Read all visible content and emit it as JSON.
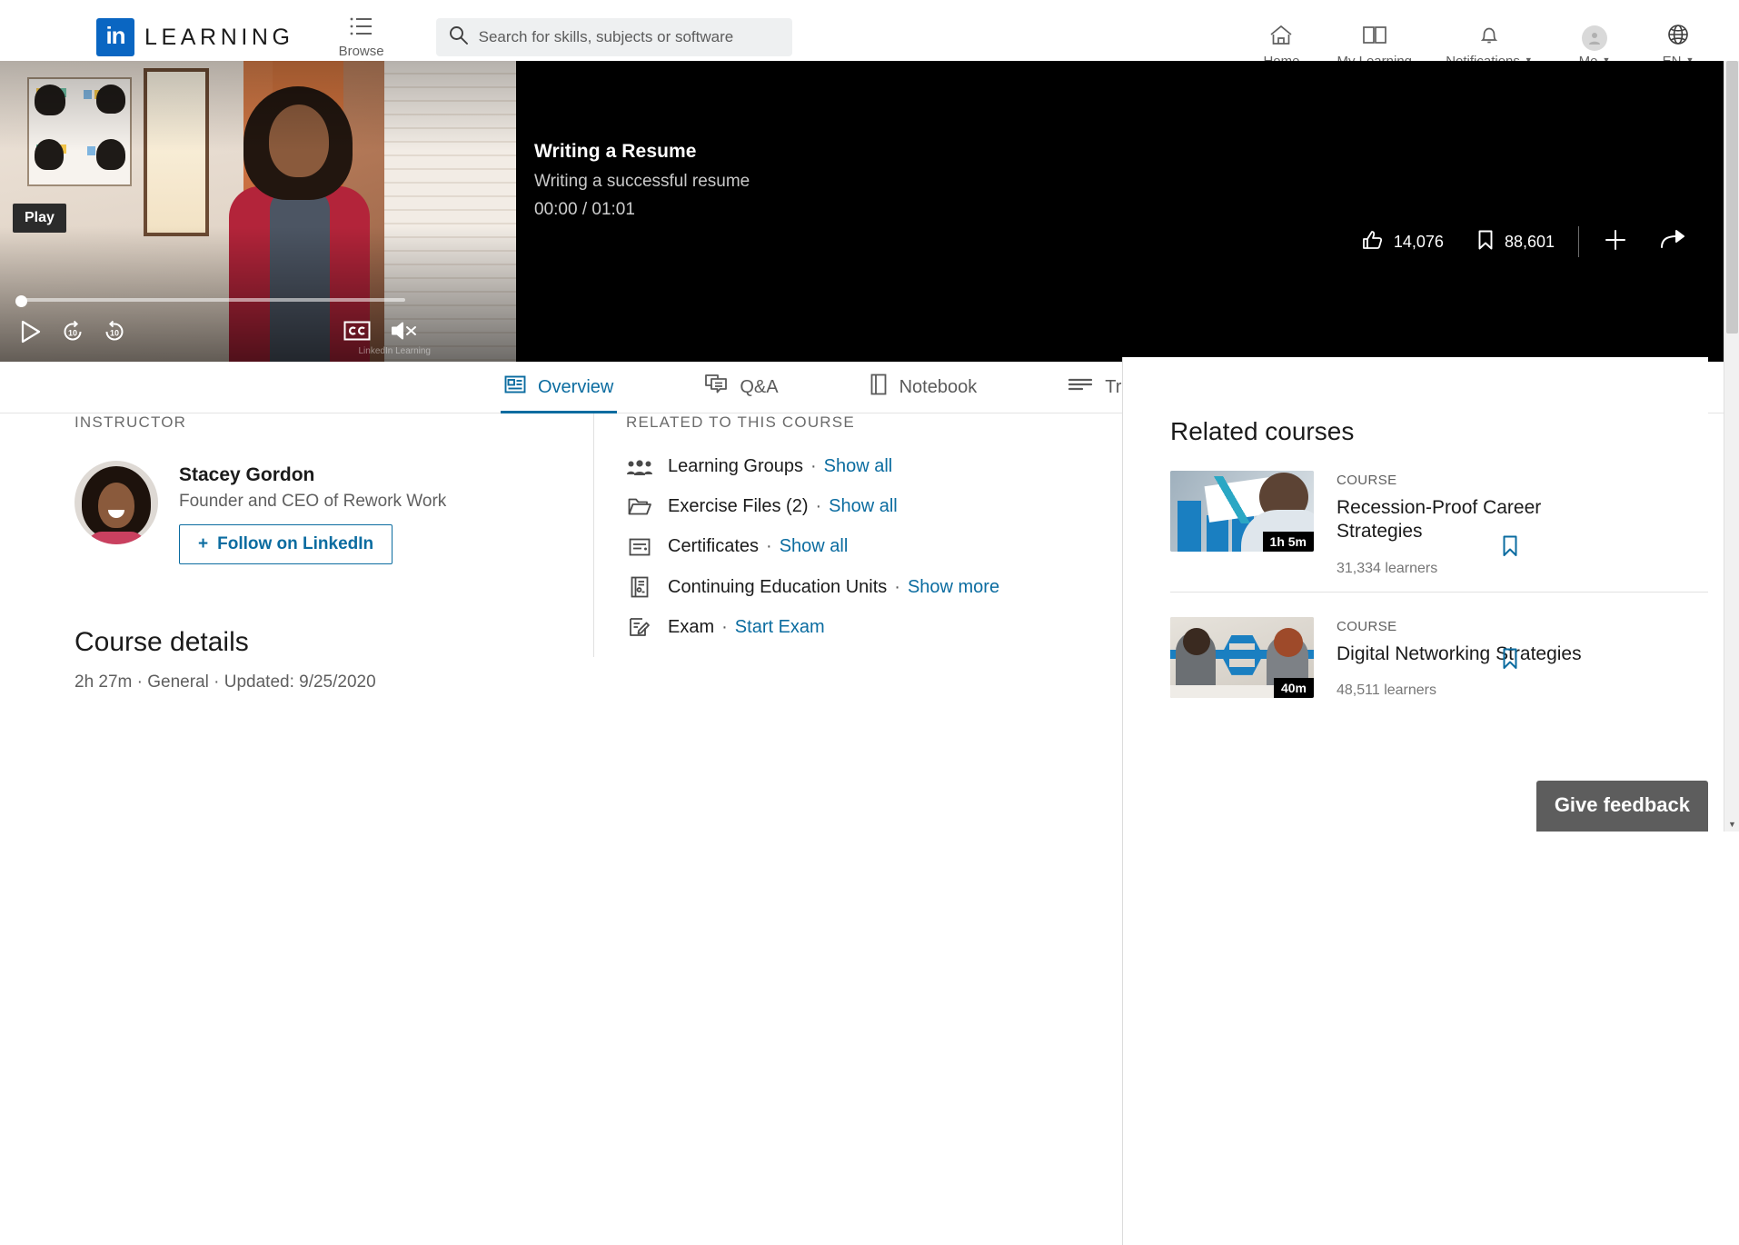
{
  "header": {
    "brand_mark": "in",
    "brand_word": "LEARNING",
    "browse_label": "Browse",
    "search": {
      "placeholder": "Search for skills, subjects or software",
      "value": "",
      "icon": "search-icon"
    },
    "nav_items": [
      {
        "label": "Home",
        "icon": "home-icon",
        "caret": ""
      },
      {
        "label": "My Learning",
        "icon": "book-icon",
        "caret": ""
      },
      {
        "label": "Notifications",
        "icon": "bell-icon",
        "caret": "▼"
      },
      {
        "label": "Me",
        "icon": "avatar-icon",
        "caret": "▼"
      },
      {
        "label": "EN",
        "icon": "globe-icon",
        "caret": "▼"
      }
    ]
  },
  "player": {
    "course_title": "Writing a Resume",
    "video_title": "Writing a successful resume",
    "time_display": "00:00 / 01:01",
    "current_time": "00:00",
    "duration": "01:01",
    "play_tooltip": "Play",
    "progress_percent": 0,
    "controls": {
      "play": "play-icon",
      "rewind_10": "10",
      "forward_10": "10",
      "captions": "CC",
      "volume": "muted"
    },
    "watermark": "LinkedIn Learning",
    "actions": {
      "likes": "14,076",
      "saves": "88,601",
      "add_label": "+",
      "share_label": "share-icon"
    }
  },
  "tabs": [
    {
      "label": "Overview",
      "icon": "overview-icon",
      "active": true
    },
    {
      "label": "Q&A",
      "icon": "qa-icon",
      "active": false
    },
    {
      "label": "Notebook",
      "icon": "notebook-icon",
      "active": false
    },
    {
      "label": "Transcript",
      "icon": "transcript-icon",
      "active": false
    }
  ],
  "instructor": {
    "eyebrow": "INSTRUCTOR",
    "name": "Stacey Gordon",
    "title": "Founder and CEO of Rework Work",
    "follow_button": "Follow on LinkedIn",
    "follow_plus": "+"
  },
  "course_details": {
    "heading": "Course details",
    "meta": "2h 27m  ·  General  ·  Updated: 9/25/2020",
    "duration": "2h 27m",
    "level": "General",
    "updated": "Updated: 9/25/2020"
  },
  "related_to_course": {
    "eyebrow": "RELATED TO THIS COURSE",
    "items": [
      {
        "label": "Learning Groups",
        "icon": "people-icon",
        "sep": "·",
        "link": "Show all"
      },
      {
        "label": "Exercise Files (2)",
        "icon": "folder-icon",
        "sep": "·",
        "link": "Show all"
      },
      {
        "label": "Certificates",
        "icon": "certificate-icon",
        "sep": "·",
        "link": "Show all"
      },
      {
        "label": "Continuing Education Units",
        "icon": "ceu-icon",
        "sep": "·",
        "link": "Show more"
      },
      {
        "label": "Exam",
        "icon": "exam-icon",
        "sep": "·",
        "link": "Start Exam"
      }
    ]
  },
  "related_courses": {
    "heading": "Related courses",
    "cards": [
      {
        "kicker": "COURSE",
        "title": "Recession-Proof Career Strategies",
        "duration": "1h 5m",
        "learners": "31,334 learners",
        "bookmark": "bookmark-icon"
      },
      {
        "kicker": "COURSE",
        "title": "Digital Networking Strategies",
        "duration": "40m",
        "learners": "48,511 learners",
        "bookmark": "bookmark-icon"
      }
    ]
  },
  "feedback": {
    "label": "Give feedback"
  },
  "colors": {
    "brand_blue": "#0a66c2",
    "link_blue": "#0b6ca0",
    "accent_teal": "#1a7fc1",
    "text_dark": "#1b1b1b",
    "text_muted": "#5f5f5f",
    "player_bg": "#000000",
    "feedback_bg": "#5d5d5d"
  }
}
